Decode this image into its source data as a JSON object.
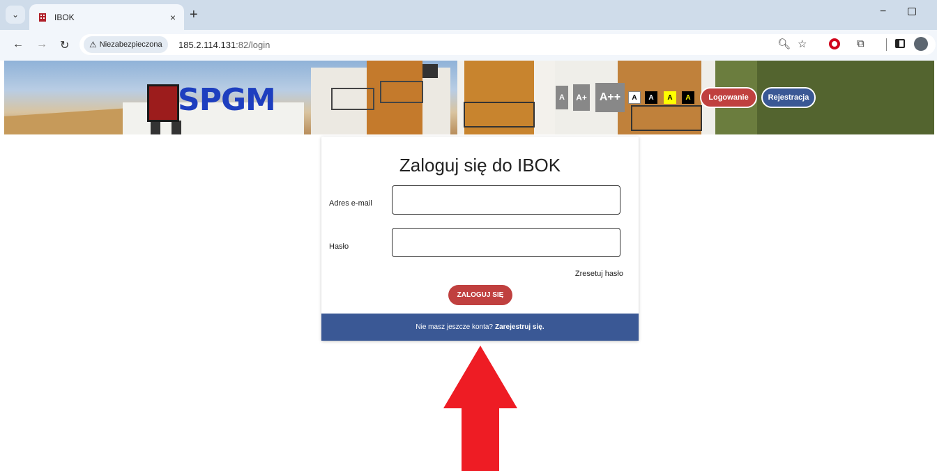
{
  "browser": {
    "tab_title": "IBOK",
    "tab_close": "×",
    "new_tab": "+",
    "minimize": "−",
    "security_label": "Niezabezpieczona",
    "url_host": "185.2.114.131",
    "url_rest": ":82/login",
    "icons": [
      "back-icon",
      "forward-icon",
      "reload-icon",
      "zoom-icon",
      "star-icon",
      "opera-icon",
      "extensions-icon",
      "sidepanel-icon",
      "profile-icon"
    ]
  },
  "header": {
    "logo_text": "SPGM",
    "font_buttons": [
      "A",
      "A+",
      "A++"
    ],
    "contrast_buttons": [
      "A",
      "A",
      "A",
      "A"
    ],
    "login_button": "Logowanie",
    "register_button": "Rejestracja"
  },
  "login_card": {
    "title": "Zaloguj się do IBOK",
    "email_label": "Adres e-mail",
    "email_value": "",
    "password_label": "Hasło",
    "password_value": "",
    "reset_link": "Zresetuj hasło",
    "submit_button": "ZALOGUJ SIĘ",
    "footer_text": "Nie masz jeszcze konta?",
    "footer_link": "Zarejestruj się."
  },
  "colors": {
    "accent_red": "#c0403f",
    "accent_blue": "#3a5895",
    "arrow_red": "#ee1c24",
    "contrast_yellow": "#ffff00"
  }
}
